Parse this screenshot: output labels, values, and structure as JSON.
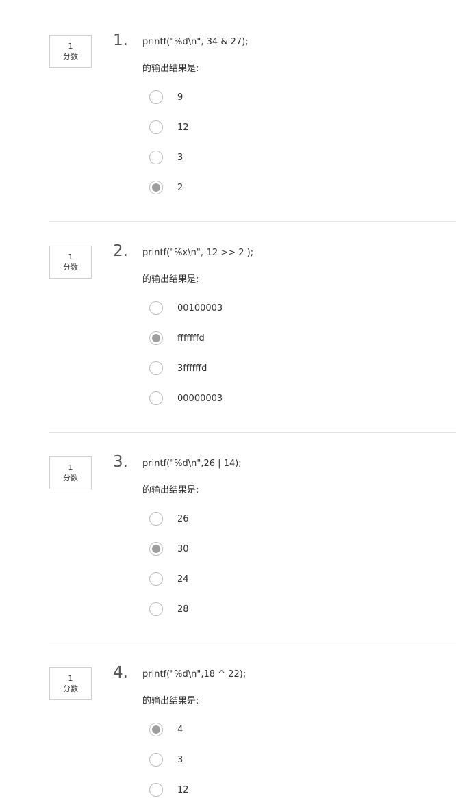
{
  "questions": [
    {
      "number": "1.",
      "points_value": "1",
      "points_unit": "分数",
      "code": "printf(\"%d\\n\", 34 & 27);",
      "prompt": "的输出结果是:",
      "options": [
        {
          "label": "9",
          "selected": false
        },
        {
          "label": "12",
          "selected": false
        },
        {
          "label": "3",
          "selected": false
        },
        {
          "label": "2",
          "selected": true
        }
      ]
    },
    {
      "number": "2.",
      "points_value": "1",
      "points_unit": "分数",
      "code": "printf(\"%x\\n\",-12 >> 2 );",
      "prompt": "的输出结果是:",
      "options": [
        {
          "label": "00100003",
          "selected": false
        },
        {
          "label": "fffffffd",
          "selected": true
        },
        {
          "label": "3ffffffd",
          "selected": false
        },
        {
          "label": "00000003",
          "selected": false
        }
      ]
    },
    {
      "number": "3.",
      "points_value": "1",
      "points_unit": "分数",
      "code": "printf(\"%d\\n\",26 | 14);",
      "prompt": "的输出结果是:",
      "options": [
        {
          "label": "26",
          "selected": false
        },
        {
          "label": "30",
          "selected": true
        },
        {
          "label": "24",
          "selected": false
        },
        {
          "label": "28",
          "selected": false
        }
      ]
    },
    {
      "number": "4.",
      "points_value": "1",
      "points_unit": "分数",
      "code": "printf(\"%d\\n\",18 ^ 22);",
      "prompt": "的输出结果是:",
      "options": [
        {
          "label": "4",
          "selected": true
        },
        {
          "label": "3",
          "selected": false
        },
        {
          "label": "12",
          "selected": false
        }
      ]
    }
  ],
  "colors": {
    "radio_border": "#bdbdbd",
    "radio_selected_fill": "#9e9e9e",
    "divider": "#e2e2e2",
    "points_border": "#cfcfcf"
  }
}
